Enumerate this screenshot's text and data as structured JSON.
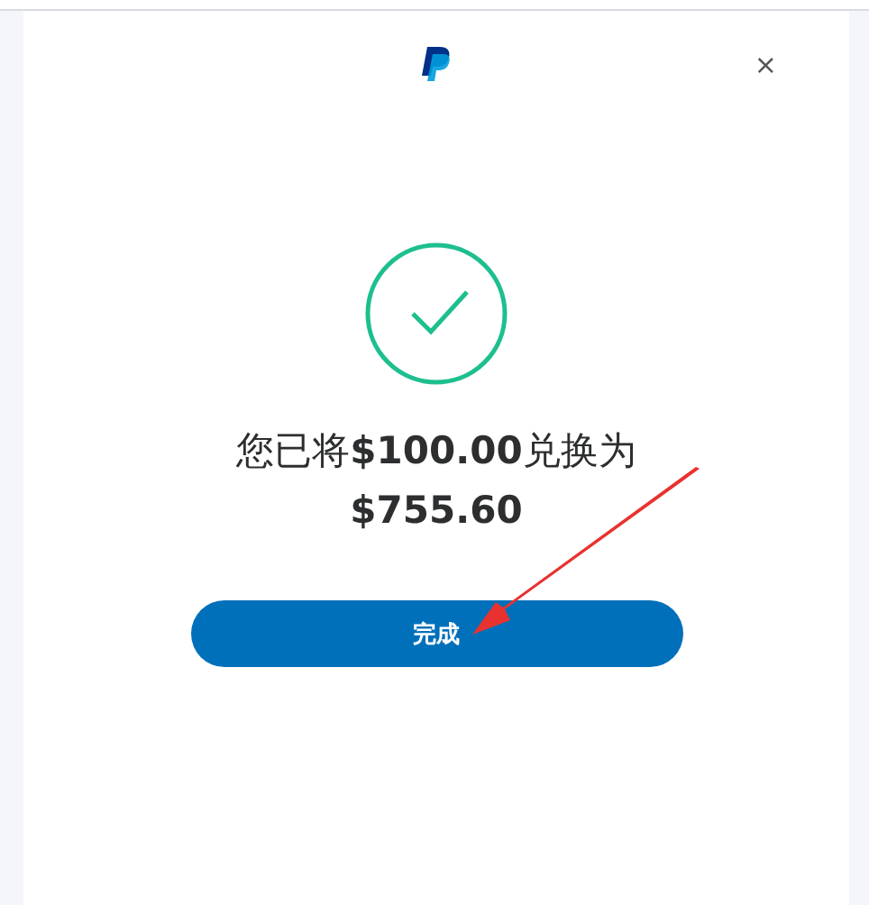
{
  "dialog": {
    "close": "×",
    "message": "您已将**$100.00**兑换为**$755.60**",
    "done_button": "完成"
  }
}
